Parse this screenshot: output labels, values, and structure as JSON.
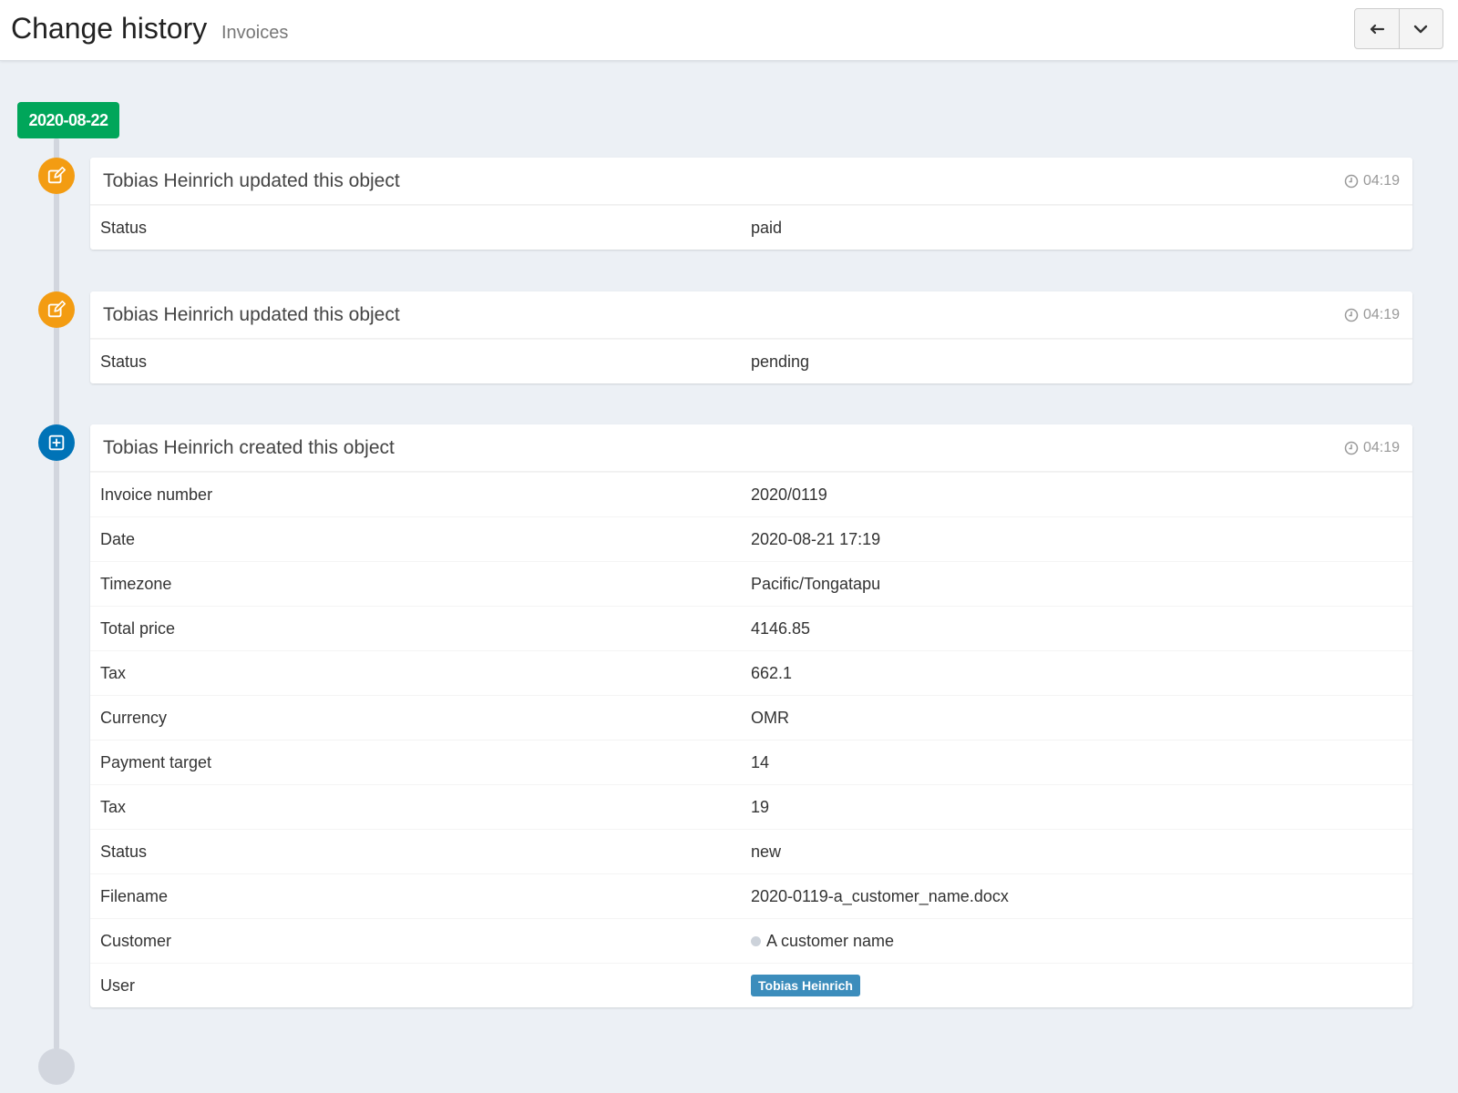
{
  "header": {
    "title": "Change history",
    "subtitle": "Invoices",
    "back_icon": "arrow-left-icon",
    "menu_icon": "chevron-down-icon"
  },
  "timeline": {
    "date": "2020-08-22",
    "entries": [
      {
        "title": "Tobias Heinrich updated this object",
        "time": "04:19",
        "icon": "edit-icon",
        "rows": [
          {
            "label": "Status",
            "value": "paid"
          }
        ]
      },
      {
        "title": "Tobias Heinrich updated this object",
        "time": "04:19",
        "icon": "edit-icon",
        "rows": [
          {
            "label": "Status",
            "value": "pending"
          }
        ]
      },
      {
        "title": "Tobias Heinrich created this object",
        "time": "04:19",
        "icon": "plus-square-icon",
        "rows": [
          {
            "label": "Invoice number",
            "value": "2020/0119"
          },
          {
            "label": "Date",
            "value": "2020-08-21 17:19"
          },
          {
            "label": "Timezone",
            "value": "Pacific/Tongatapu"
          },
          {
            "label": "Total price",
            "value": "4146.85"
          },
          {
            "label": "Tax",
            "value": "662.1"
          },
          {
            "label": "Currency",
            "value": "OMR"
          },
          {
            "label": "Payment target",
            "value": "14"
          },
          {
            "label": "Tax",
            "value": "19"
          },
          {
            "label": "Status",
            "value": "new"
          },
          {
            "label": "Filename",
            "value": "2020-0119-a_customer_name.docx"
          },
          {
            "label": "Customer",
            "value": "A customer name"
          },
          {
            "label": "User",
            "value": "Tobias Heinrich"
          }
        ]
      }
    ]
  },
  "colors": {
    "date_label": "#00a65a",
    "update_icon": "#f39c12",
    "create_icon": "#0073b7",
    "user_badge": "#3c8dbc"
  }
}
